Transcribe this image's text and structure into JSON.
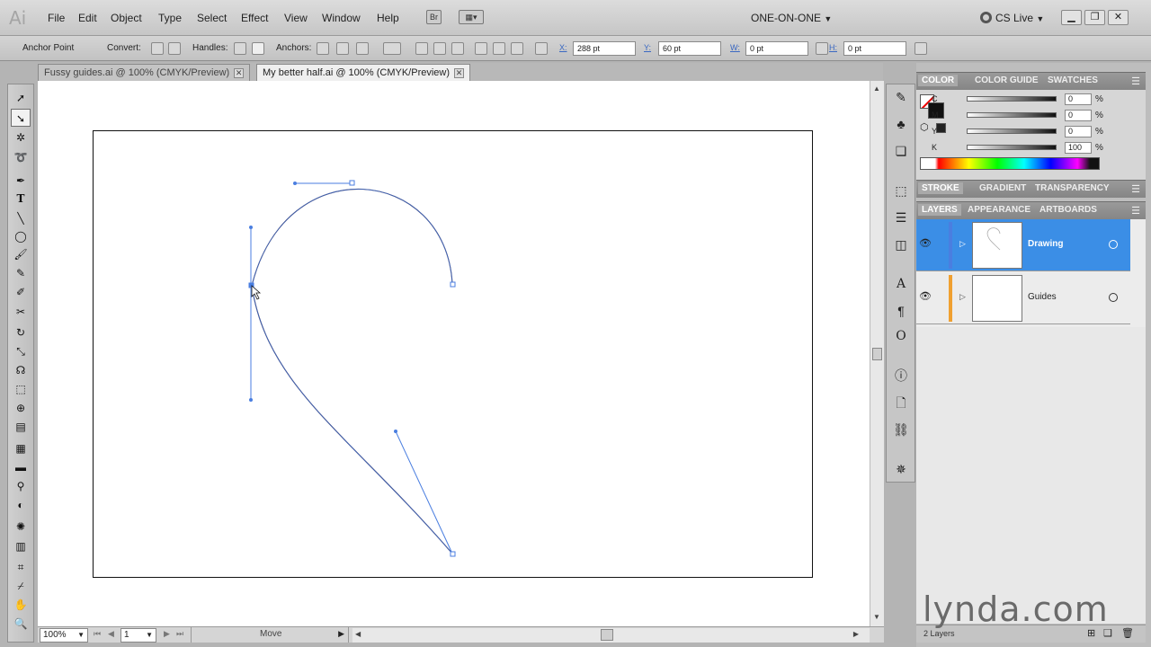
{
  "app": {
    "logo": "Ai"
  },
  "menubar": {
    "items": [
      "File",
      "Edit",
      "Object",
      "Type",
      "Select",
      "Effect",
      "View",
      "Window",
      "Help"
    ],
    "bridge": "Br",
    "workspace": "ONE-ON-ONE",
    "cslive": "CS Live"
  },
  "control": {
    "anchor_point": "Anchor Point",
    "convert": "Convert:",
    "handles": "Handles:",
    "anchors": "Anchors:",
    "x_label": "X:",
    "x_value": "288 pt",
    "y_label": "Y:",
    "y_value": "60 pt",
    "w_label": "W:",
    "w_value": "0 pt",
    "h_label": "H:",
    "h_value": "0 pt"
  },
  "tabs": [
    {
      "label": "Fussy guides.ai @ 100% (CMYK/Preview)",
      "active": false
    },
    {
      "label": "My better half.ai @ 100% (CMYK/Preview)",
      "active": true
    }
  ],
  "toolbox": {
    "icons": [
      "selection-icon",
      "direct-selection-icon",
      "magic-wand-icon",
      "lasso-icon",
      "pen-icon",
      "type-icon",
      "line-segment-icon",
      "ellipse-icon",
      "paintbrush-icon",
      "pencil-icon",
      "blob-brush-icon",
      "scissors-icon",
      "rotate-icon",
      "scale-icon",
      "warp-icon",
      "free-transform-icon",
      "shape-builder-icon",
      "perspective-grid-icon",
      "mesh-icon",
      "gradient-icon",
      "eyedropper-icon",
      "blend-icon",
      "symbol-sprayer-icon",
      "column-graph-icon",
      "artboard-icon",
      "slice-icon",
      "hand-icon",
      "zoom-icon"
    ]
  },
  "color_panel": {
    "tabs": [
      "COLOR",
      "COLOR GUIDE",
      "SWATCHES"
    ],
    "sliders": [
      {
        "label": "C",
        "value": "0"
      },
      {
        "label": "M",
        "value": "0"
      },
      {
        "label": "Y",
        "value": "0"
      },
      {
        "label": "K",
        "value": "100"
      }
    ],
    "percent": "%"
  },
  "stroke_panel": {
    "tabs": [
      "STROKE",
      "GRADIENT",
      "TRANSPARENCY"
    ]
  },
  "layers_panel": {
    "tabs": [
      "LAYERS",
      "APPEARANCE",
      "ARTBOARDS"
    ],
    "layers": [
      {
        "name": "Drawing",
        "color": "#4a7ee0",
        "selected": true
      },
      {
        "name": "Guides",
        "color": "#f0a030",
        "selected": false
      }
    ],
    "count_label": "2 Layers"
  },
  "status": {
    "zoom": "100%",
    "artboard": "1",
    "tool": "Move"
  },
  "watermark": "lynda.com"
}
